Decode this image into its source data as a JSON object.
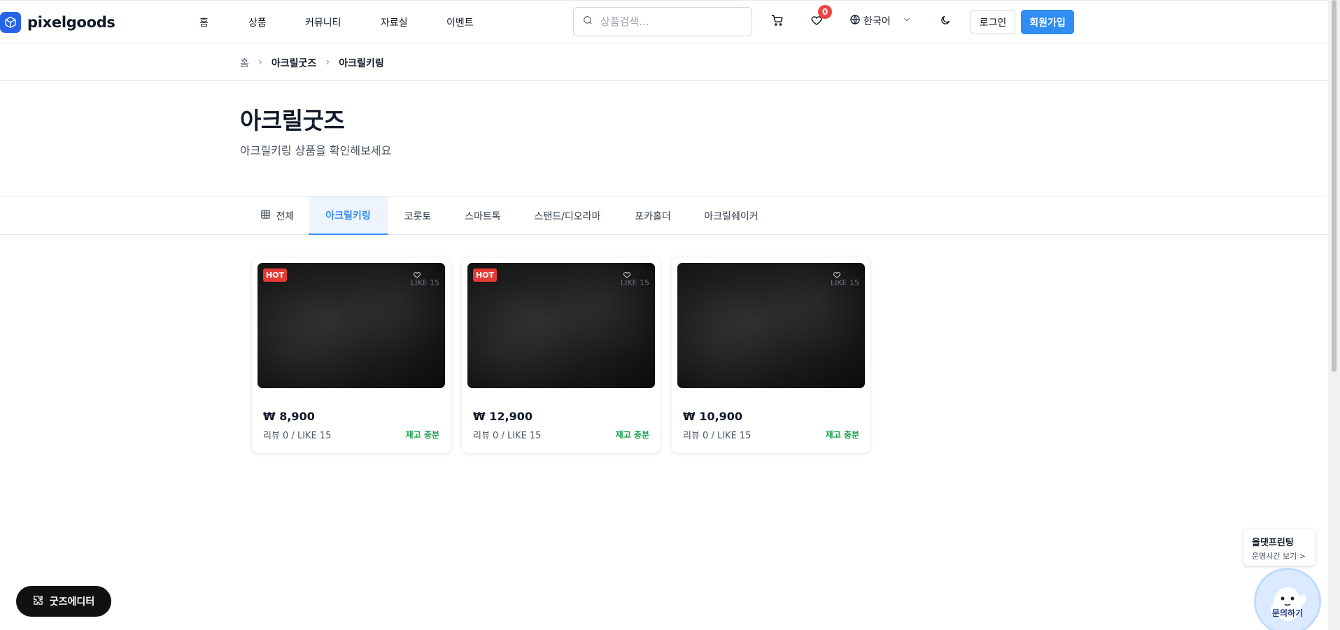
{
  "brand": {
    "name": "pixelgoods",
    "logo_icon": "cube-icon"
  },
  "nav": {
    "items": [
      "홈",
      "상품",
      "커뮤니티",
      "자료실",
      "이벤트"
    ]
  },
  "search": {
    "placeholder": "상품검색..."
  },
  "header": {
    "wishlist_count": "0",
    "language": "한국어",
    "login_label": "로그인",
    "signup_label": "회원가입",
    "icons": [
      "search-icon",
      "cart-icon",
      "heart-icon",
      "globe-icon",
      "chevron-down-icon",
      "moon-icon"
    ]
  },
  "breadcrumb": [
    "홈",
    "아크릴굿즈",
    "아크릴키링"
  ],
  "page": {
    "title": "아크릴굿즈",
    "subtitle": "아크릴키링 상품을 확인해보세요"
  },
  "tabs": [
    {
      "label": "전체",
      "icon": "grid-icon",
      "active": false
    },
    {
      "label": "아크릴키링",
      "active": true
    },
    {
      "label": "코롯토",
      "active": false
    },
    {
      "label": "스마트톡",
      "active": false
    },
    {
      "label": "스탠드/디오라마",
      "active": false
    },
    {
      "label": "포카홀더",
      "active": false
    },
    {
      "label": "아크릴쉐이커",
      "active": false
    }
  ],
  "products": [
    {
      "badge": "HOT",
      "like_label": "LIKE 15",
      "price": "₩ 8,900",
      "meta": "리뷰 0 / LIKE 15",
      "stock": "재고 충분"
    },
    {
      "badge": "HOT",
      "like_label": "LIKE 15",
      "price": "₩ 12,900",
      "meta": "리뷰 0 / LIKE 15",
      "stock": "재고 충분"
    },
    {
      "badge": "",
      "like_label": "LIKE 15",
      "price": "₩ 10,900",
      "meta": "리뷰 0 / LIKE 15",
      "stock": "재고 충분"
    }
  ],
  "floating": {
    "editor_label": "굿즈에디터",
    "hours_title": "올댓프린팅",
    "hours_link": "운영시간 보기 >",
    "inquiry_label": "문의하기"
  },
  "colors": {
    "primary": "#2f8df3",
    "hot_badge": "#e53935",
    "stock_green": "#16a34a",
    "wish_badge": "#ef4444"
  }
}
